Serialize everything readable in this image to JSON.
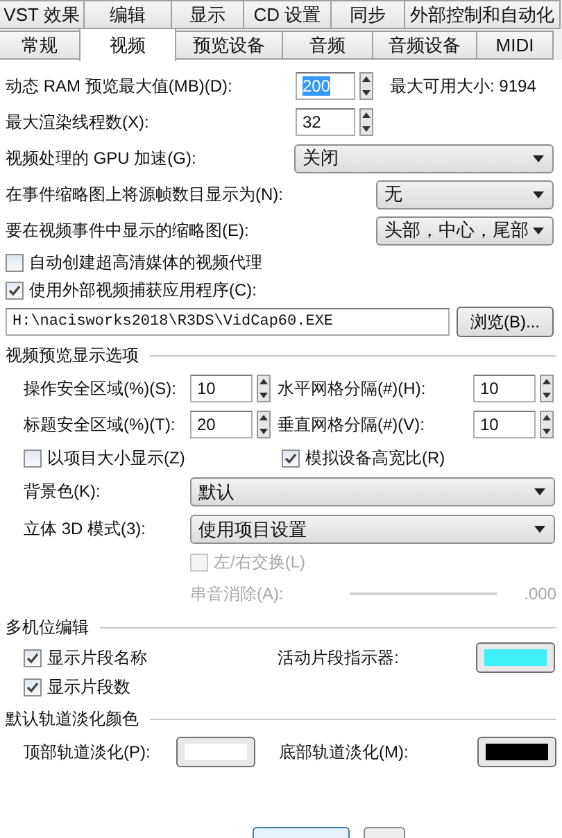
{
  "tabs_back": [
    {
      "label": "VST 效果",
      "selected": false
    },
    {
      "label": "编辑",
      "selected": false
    },
    {
      "label": "显示",
      "selected": false
    },
    {
      "label": "CD 设置",
      "selected": false
    },
    {
      "label": "同步",
      "selected": false
    },
    {
      "label": "外部控制和自动化",
      "selected": false
    }
  ],
  "tabs_front": [
    {
      "label": "常规",
      "selected": false
    },
    {
      "label": "视频",
      "selected": true
    },
    {
      "label": "预览设备",
      "selected": false
    },
    {
      "label": "音频",
      "selected": false
    },
    {
      "label": "音频设备",
      "selected": false
    },
    {
      "label": "MIDI",
      "selected": false
    }
  ],
  "ram_preview": {
    "label": "动态 RAM 预览最大值(MB)(D):",
    "value": "200",
    "selected": true,
    "note": "最大可用大小: 9194"
  },
  "render_threads": {
    "label": "最大渲染线程数(X):",
    "value": "32",
    "selected": false
  },
  "dropdowns": [
    {
      "label": "视频处理的 GPU 加速(G):",
      "value": "关闭",
      "wide": true
    },
    {
      "label": "在事件缩略图上将源帧数目显示为(N):",
      "value": "无",
      "wide": false
    },
    {
      "label": "要在视频事件中显示的缩略图(E):",
      "value": "头部，中心，尾部",
      "wide": false
    }
  ],
  "checkboxes": [
    {
      "label": "自动创建超高清媒体的视频代理",
      "checked": false
    },
    {
      "label": "使用外部视频捕获应用程序(C):",
      "checked": true
    }
  ],
  "capture_path": {
    "value": "H:\\nacisworks2018\\R3DS\\VidCap60.EXE",
    "button": "浏览(B)..."
  },
  "preview_options": {
    "title": "视频预览显示选项",
    "fields": [
      {
        "label": "操作安全区域(%)(S):",
        "value": "10"
      },
      {
        "label": "水平网格分隔(#)(H):",
        "value": "10"
      },
      {
        "label": "标题安全区域(%)(T):",
        "value": "20"
      },
      {
        "label": "垂直网格分隔(#)(V):",
        "value": "10"
      }
    ],
    "checkboxes": [
      {
        "label": "以项目大小显示(Z)",
        "checked": false
      },
      {
        "label": "模拟设备高宽比(R)",
        "checked": true
      }
    ],
    "dropdowns": [
      {
        "label": "背景色(K):",
        "value": "默认"
      },
      {
        "label": "立体 3D 模式(3):",
        "value": "使用项目设置"
      }
    ],
    "swap": {
      "label": "左/右交换(L)",
      "checked": false,
      "disabled": true
    },
    "crosstalk": {
      "label": "串音消除(A):",
      "reading": ".000",
      "disabled": true
    }
  },
  "multicam": {
    "title": "多机位编辑",
    "checkboxes": [
      {
        "label": "显示片段名称",
        "checked": true
      },
      {
        "label": "显示片段数",
        "checked": true
      }
    ],
    "indicator": {
      "label": "活动片段指示器:",
      "color": "#40f0f8"
    }
  },
  "fade": {
    "title": "默认轨道淡化颜色",
    "items": [
      {
        "label": "顶部轨道淡化(P):",
        "color": "#ffffff"
      },
      {
        "label": "底部轨道淡化(M):",
        "color": "#000000"
      }
    ]
  }
}
